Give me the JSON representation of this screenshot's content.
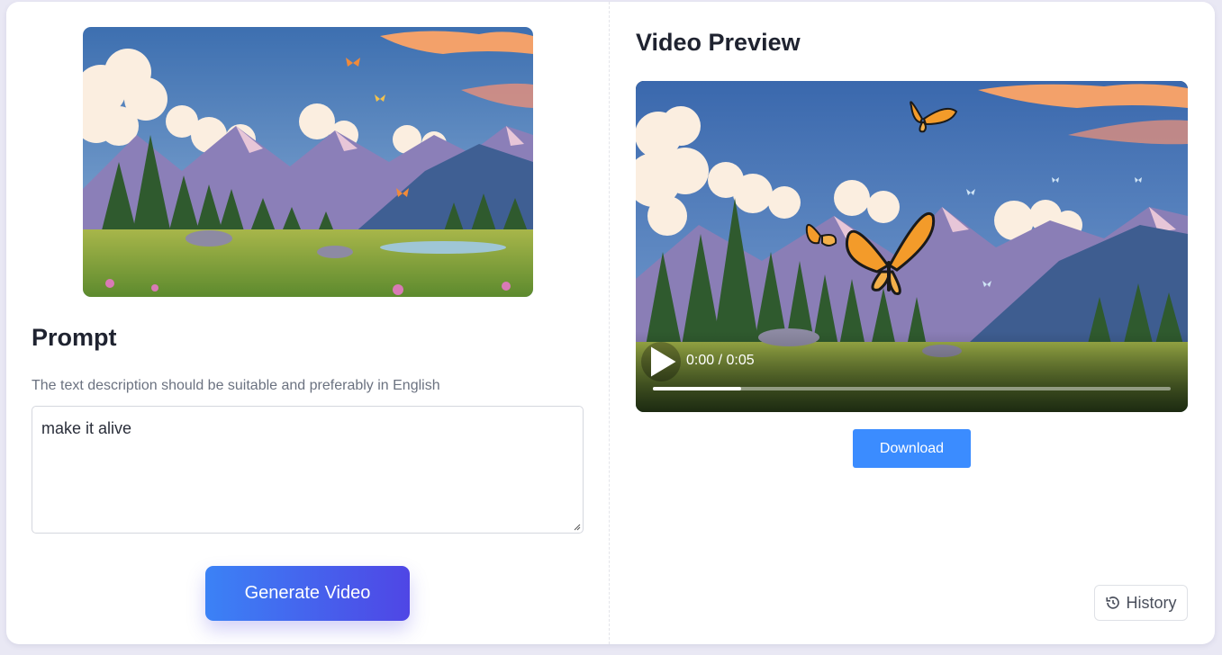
{
  "left_panel": {
    "source_image_alt": "",
    "prompt_title": "Prompt",
    "prompt_hint": "The text description should be suitable and preferably in English",
    "prompt_value": "make it alive",
    "generate_label": "Generate Video"
  },
  "right_panel": {
    "preview_title": "Video Preview",
    "video": {
      "time_display": "0:00 / 0:05",
      "progress_fraction": 0.17,
      "muted": true,
      "icons": [
        "play-icon",
        "mute-icon",
        "fullscreen-icon",
        "more-vertical-icon"
      ]
    },
    "download_label": "Download",
    "history_label": "History",
    "history_icon": "history-icon"
  },
  "colors": {
    "accent": "#3b8cff",
    "gradient_start": "#3b82f6",
    "gradient_end": "#4f46e5",
    "heading": "#1f2330"
  }
}
